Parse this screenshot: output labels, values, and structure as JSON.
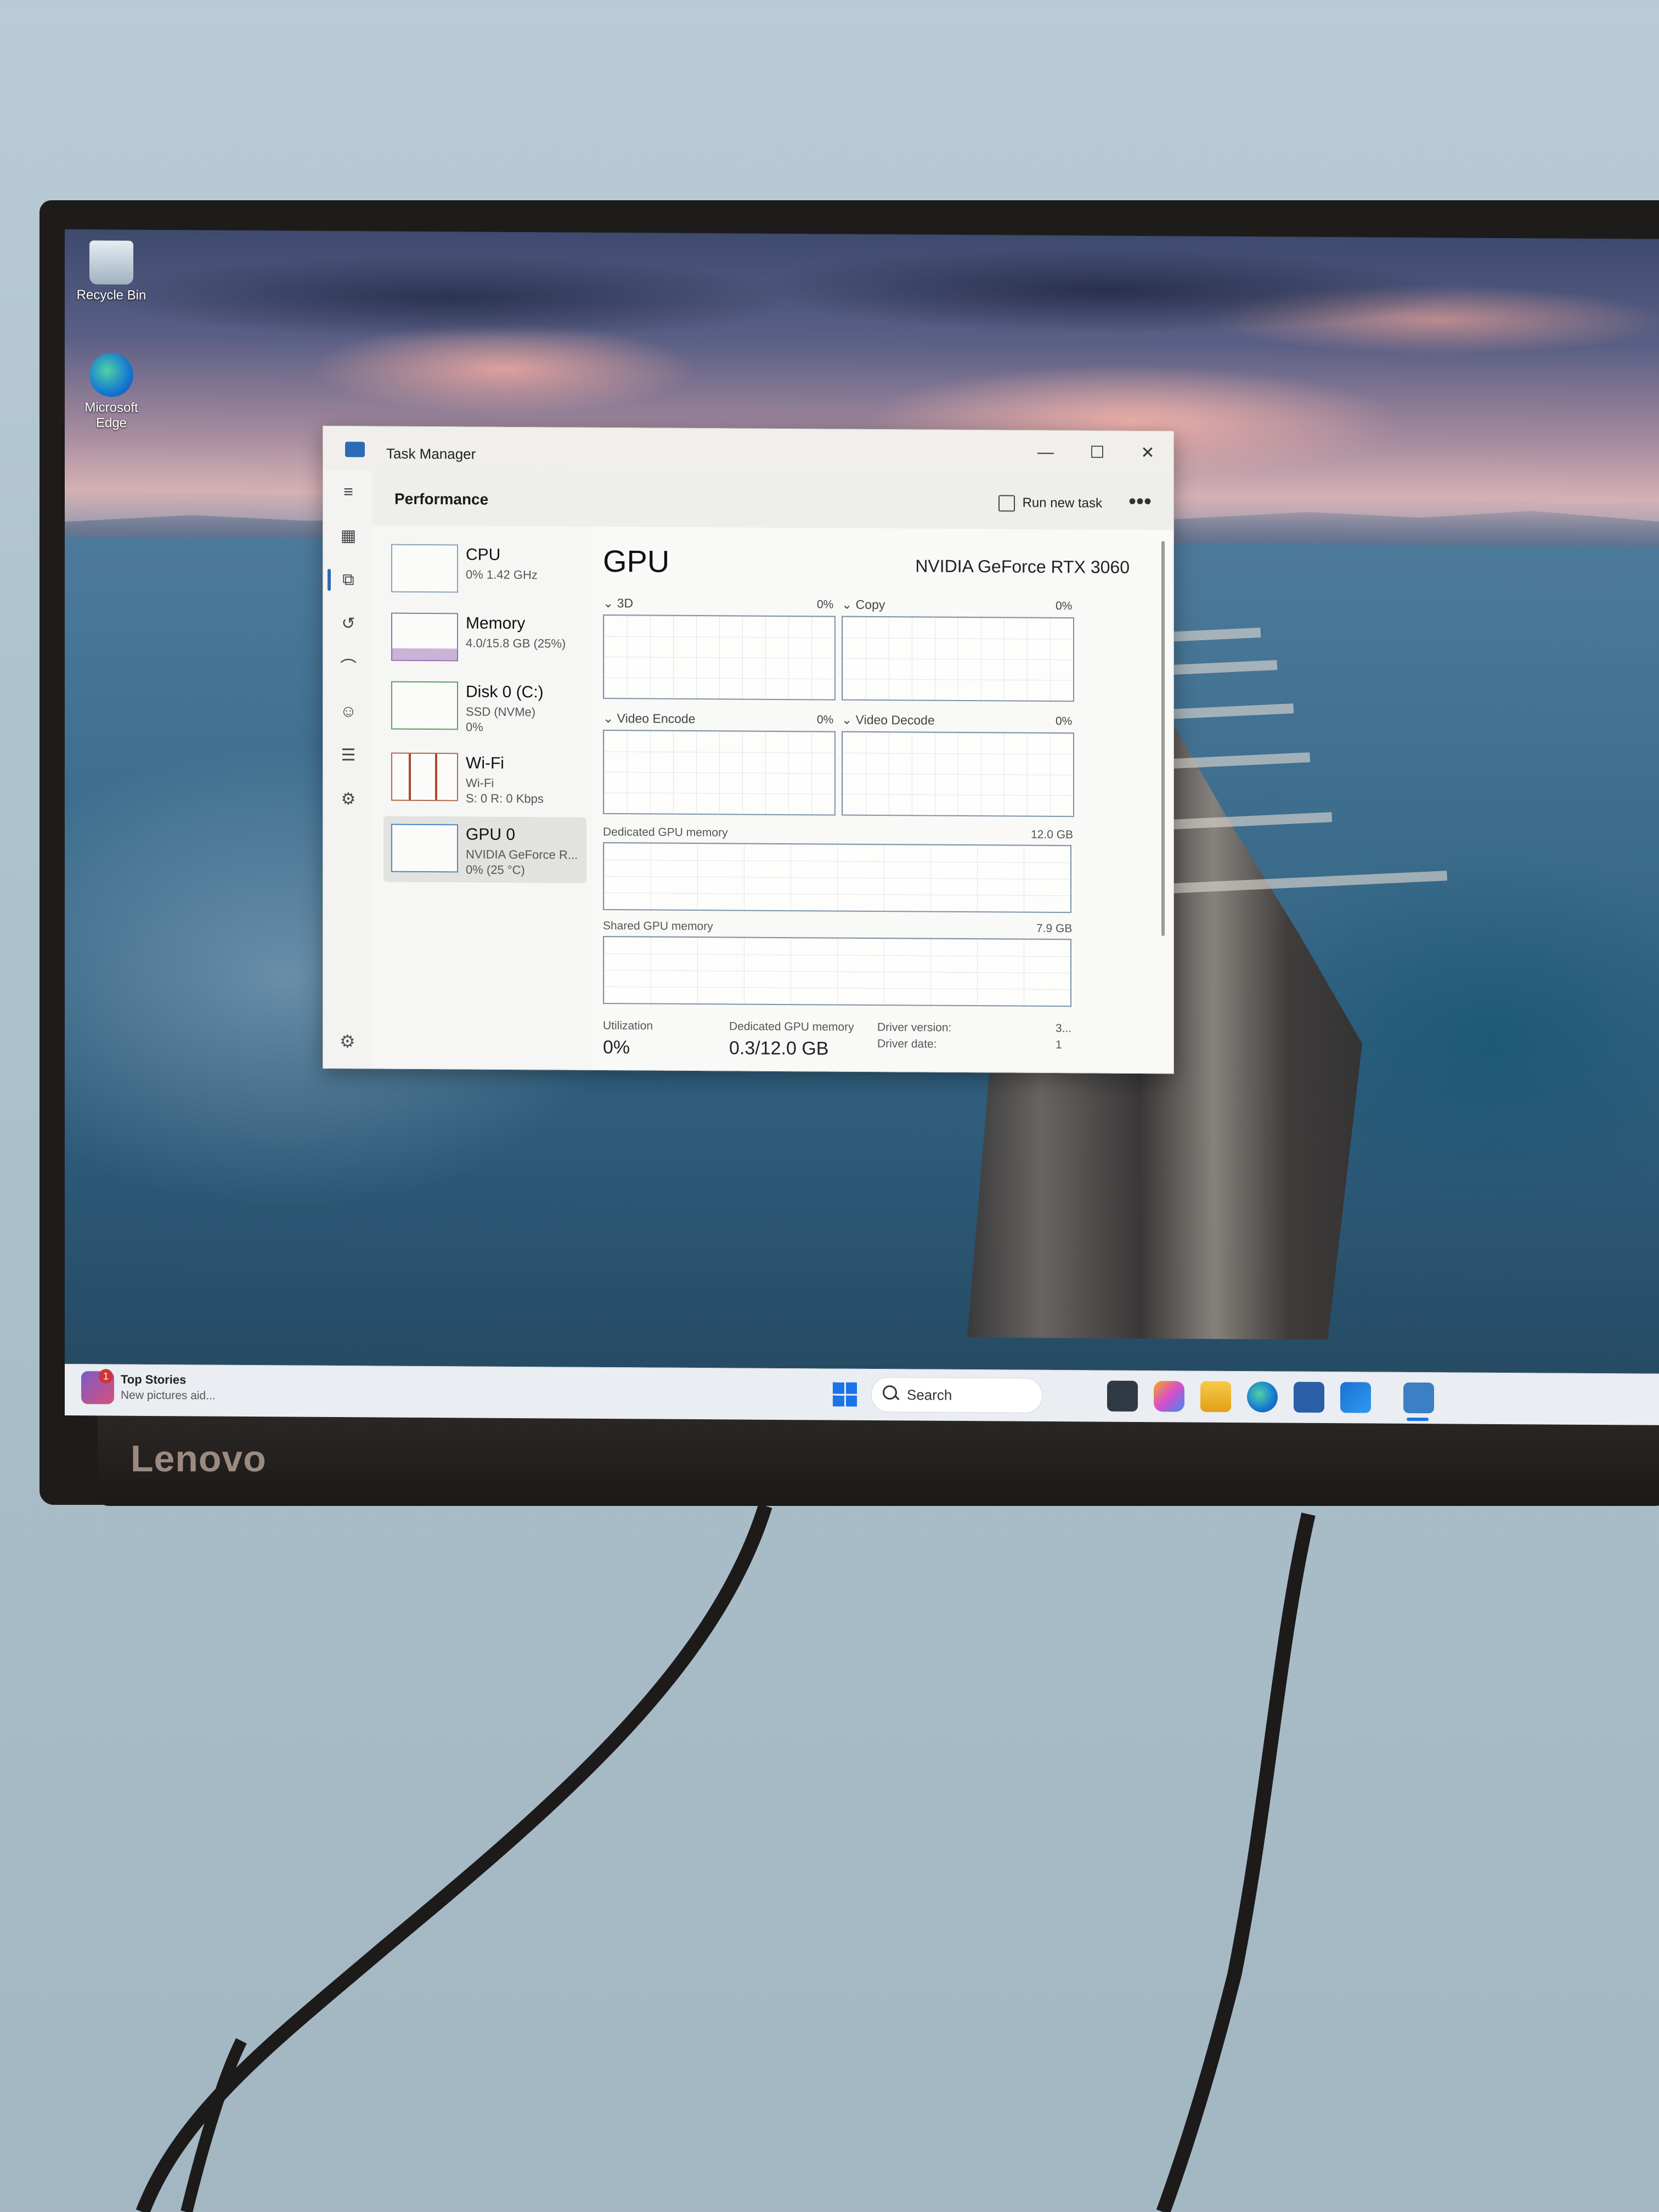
{
  "monitor": {
    "brand": "Lenovo"
  },
  "desktop": {
    "icons": [
      {
        "label": "Recycle Bin",
        "icon": "recycle-bin-icon"
      },
      {
        "label": "Microsoft Edge",
        "icon": "edge-browser-icon"
      }
    ]
  },
  "task_manager": {
    "window_title": "Task Manager",
    "window_controls": {
      "minimize": "—",
      "maximize": "☐",
      "close": "✕"
    },
    "page_title": "Performance",
    "run_new_task_label": "Run new task",
    "more_label": "•••",
    "nav_icons": [
      "hamburger-icon",
      "processes-icon",
      "performance-icon",
      "app-history-icon",
      "startup-apps-icon",
      "users-icon",
      "details-icon",
      "services-icon"
    ],
    "devices": [
      {
        "name": "CPU",
        "line1": "0% 1.42 GHz",
        "line2": ""
      },
      {
        "name": "Memory",
        "line1": "4.0/15.8 GB (25%)",
        "line2": ""
      },
      {
        "name": "Disk 0 (C:)",
        "line1": "SSD (NVMe)",
        "line2": "0%"
      },
      {
        "name": "Wi-Fi",
        "line1": "Wi-Fi",
        "line2": "S: 0 R: 0 Kbps"
      },
      {
        "name": "GPU 0",
        "line1": "NVIDIA GeForce R...",
        "line2": "0% (25 °C)"
      }
    ],
    "selected_device": "GPU 0",
    "gpu": {
      "title": "GPU",
      "model": "NVIDIA GeForce RTX 3060",
      "engines": [
        {
          "label": "3D",
          "value": "0%"
        },
        {
          "label": "Copy",
          "value": "0%"
        },
        {
          "label": "Video Encode",
          "value": "0%"
        },
        {
          "label": "Video Decode",
          "value": "0%"
        }
      ],
      "dedicated_memory": {
        "label": "Dedicated GPU memory",
        "max": "12.0 GB"
      },
      "shared_memory": {
        "label": "Shared GPU memory",
        "max": "7.9 GB"
      },
      "stats": {
        "utilization_label": "Utilization",
        "utilization_value": "0%",
        "dedicated_label": "Dedicated GPU memory",
        "dedicated_value": "0.3/12.0 GB",
        "driver_version_label": "Driver version:",
        "driver_version_value": "3...",
        "driver_date_label": "Driver date:",
        "driver_date_value": "1"
      }
    }
  },
  "taskbar": {
    "widget_title": "Top Stories",
    "widget_sub": "New pictures aid...",
    "widget_badge": "1",
    "search_placeholder": "Search",
    "apps": [
      "file-explorer-icon",
      "copilot-icon",
      "folder-icon",
      "edge-icon",
      "store-icon",
      "outlook-icon",
      "task-manager-icon"
    ],
    "accent": "#1a73e8"
  }
}
